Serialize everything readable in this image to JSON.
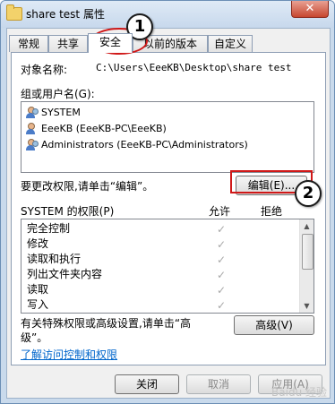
{
  "window": {
    "title": "share test 属性",
    "close_label": "✕"
  },
  "tabs": [
    {
      "label": "常规",
      "active": false
    },
    {
      "label": "共享",
      "active": false
    },
    {
      "label": "安全",
      "active": true
    },
    {
      "label": "以前的版本",
      "active": false
    },
    {
      "label": "自定义",
      "active": false
    }
  ],
  "security": {
    "object_label": "对象名称:",
    "object_value": "C:\\Users\\EeeKB\\Desktop\\share test",
    "group_label": "组或用户名(G):",
    "users": [
      {
        "name": "SYSTEM",
        "icon": "group-users-icon"
      },
      {
        "name": "EeeKB (EeeKB-PC\\EeeKB)",
        "icon": "user-icon"
      },
      {
        "name": "Administrators (EeeKB-PC\\Administrators)",
        "icon": "group-users-icon"
      }
    ],
    "change_perm_text": "要更改权限,请单击“编辑”。",
    "edit_button": "编辑(E)...",
    "perm_title": "SYSTEM 的权限(P)",
    "col_allow": "允许",
    "col_deny": "拒绝",
    "permissions": [
      {
        "name": "完全控制",
        "allow": "✓"
      },
      {
        "name": "修改",
        "allow": "✓"
      },
      {
        "name": "读取和执行",
        "allow": "✓"
      },
      {
        "name": "列出文件夹内容",
        "allow": "✓"
      },
      {
        "name": "读取",
        "allow": "✓"
      },
      {
        "name": "写入",
        "allow": "✓"
      }
    ],
    "advanced_text_line1": "有关特殊权限或高级设置,请单击“高",
    "advanced_text_line2": "级”。",
    "advanced_button": "高级(V)",
    "learn_link": "了解访问控制和权限"
  },
  "footer": {
    "ok": "关闭",
    "cancel": "取消",
    "apply": "应用(A)"
  },
  "annotations": {
    "callout1": "1",
    "callout2": "2"
  },
  "watermark": "Baidu 经验"
}
